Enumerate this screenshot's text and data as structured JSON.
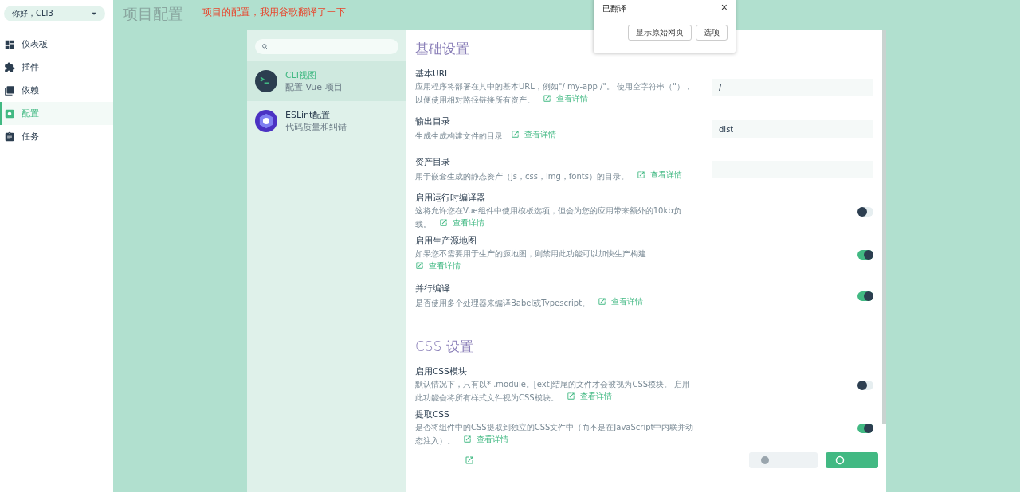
{
  "sidebar": {
    "user": "你好，CLI3",
    "items": [
      {
        "label": "仪表板",
        "selected": false
      },
      {
        "label": "插件",
        "selected": false
      },
      {
        "label": "依赖",
        "selected": false
      },
      {
        "label": "配置",
        "selected": true
      },
      {
        "label": "任务",
        "selected": false
      }
    ]
  },
  "header": {
    "title": "项目配置",
    "note": "项目的配置，我用谷歌翻译了一下"
  },
  "config_list": {
    "items": [
      {
        "title": "CLI视图",
        "subtitle": "配置 Vue 项目",
        "selected": true
      },
      {
        "title": "ESLint配置",
        "subtitle": "代码质量和纠错",
        "selected": false
      }
    ]
  },
  "sections": [
    {
      "title": "基础设置",
      "items": [
        {
          "kind": "text",
          "label": "基本URL",
          "description": "应用程序将部署在其中的基本URL，例如\"/ my-app /\"。 使用空字符串（\"），以便使用相对路径链接所有资产。",
          "link": "查看详情",
          "value": "/"
        },
        {
          "kind": "text",
          "label": "输出目录",
          "description": "生成生成构建文件的目录",
          "link": "查看详情",
          "value": "dist"
        },
        {
          "kind": "text",
          "label": "资产目录",
          "description": "用于嵌套生成的静态资产（js，css，img，fonts）的目录。",
          "link": "查看详情",
          "value": ""
        },
        {
          "kind": "toggle",
          "label": "启用运行时编译器",
          "description": "这将允许您在Vue组件中使用模板选项，但会为您的应用带来额外的10kb负载。",
          "link": "查看详情",
          "on": false
        },
        {
          "kind": "toggle",
          "label": "启用生产源地图",
          "description": "如果您不需要用于生产的源地图，则禁用此功能可以加快生产构建",
          "link": "查看详情",
          "on": true
        },
        {
          "kind": "toggle",
          "label": "并行编译",
          "description": "是否使用多个处理器来编译Babel或Typescript。",
          "link": "查看详情",
          "on": true
        }
      ]
    },
    {
      "title": "CSS 设置",
      "items": [
        {
          "kind": "toggle",
          "label": "启用CSS模块",
          "description": "默认情况下，只有以* .module。[ext]结尾的文件才会被视为CSS模块。 启用此功能会将所有样式文件视为CSS模块。",
          "link": "查看详情",
          "on": false
        },
        {
          "kind": "toggle",
          "label": "提取CSS",
          "description": "是否将组件中的CSS提取到独立的CSS文件中（而不是在JavaScript中内联并动态注入）。",
          "link": "查看详情",
          "on": true
        }
      ]
    }
  ],
  "translate_popup": {
    "title": "已翻译",
    "close": "×",
    "buttons": [
      "显示原始网页",
      "选项"
    ]
  }
}
